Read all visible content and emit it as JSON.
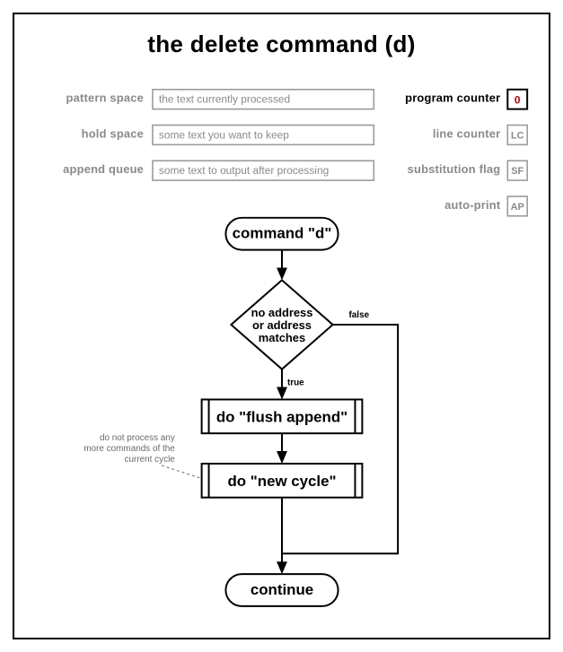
{
  "title": "the delete command (d)",
  "fields": {
    "pattern_space": {
      "label": "pattern space",
      "value": "the text currently processed"
    },
    "hold_space": {
      "label": "hold space",
      "value": "some text you want to keep"
    },
    "append_queue": {
      "label": "append queue",
      "value": "some text to output after processing"
    }
  },
  "registers": {
    "program_counter": {
      "label": "program counter",
      "code": "0",
      "highlight": true
    },
    "line_counter": {
      "label": "line counter",
      "code": "LC",
      "highlight": false
    },
    "substitution_flag": {
      "label": "substitution flag",
      "code": "SF",
      "highlight": false
    },
    "auto_print": {
      "label": "auto-print",
      "code": "AP",
      "highlight": false
    }
  },
  "flow": {
    "start": "command \"d\"",
    "decision": {
      "l1": "no address",
      "l2": "or address",
      "l3": "matches"
    },
    "true_label": "true",
    "false_label": "false",
    "step1": "do \"flush append\"",
    "step2": "do \"new cycle\"",
    "end": "continue",
    "annotation": {
      "l1": "do not process any",
      "l2": "more commands of the",
      "l3": "current cycle"
    }
  }
}
